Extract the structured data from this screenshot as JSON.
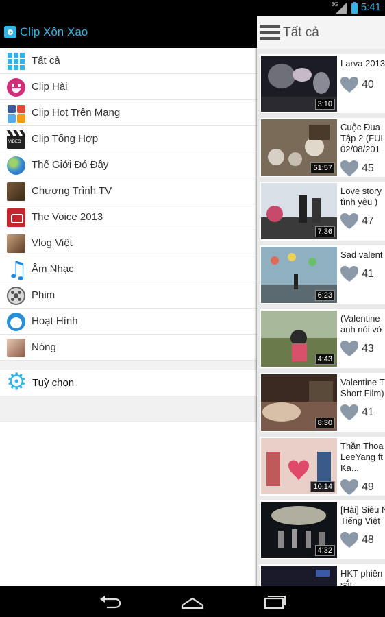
{
  "status": {
    "network": "3G",
    "time": "5:41"
  },
  "drawer": {
    "app_title": "Clip Xôn Xao",
    "items": [
      {
        "label": "Tất cả",
        "icon": "grid-icon"
      },
      {
        "label": "Clip Hài",
        "icon": "smiley-icon"
      },
      {
        "label": "Clip Hot Trên Mạng",
        "icon": "social-icon"
      },
      {
        "label": "Clip Tổng Hợp",
        "icon": "clapperboard-icon"
      },
      {
        "label": "Thế Giới Đó Đây",
        "icon": "globe-icon"
      },
      {
        "label": "Chương Trình TV",
        "icon": "tv-host-photo-icon"
      },
      {
        "label": "The Voice 2013",
        "icon": "the-voice-icon"
      },
      {
        "label": "Vlog Việt",
        "icon": "vlog-photo-icon"
      },
      {
        "label": "Âm Nhạc",
        "icon": "music-note-icon"
      },
      {
        "label": "Phim",
        "icon": "film-reel-icon"
      },
      {
        "label": "Hoạt Hình",
        "icon": "doraemon-icon"
      },
      {
        "label": "Nóng",
        "icon": "hot-photo-icon"
      }
    ],
    "options_label": "Tuỳ chọn"
  },
  "panel": {
    "title": "Tất cả",
    "videos": [
      {
        "title": "Larva 2013",
        "duration": "3:10",
        "likes": "40"
      },
      {
        "title": "Cuộc Đua\nTập 2 (FUL\n02/08/201",
        "duration": "51:57",
        "likes": "45"
      },
      {
        "title": "Love story\ntình yêu )",
        "duration": "7:36",
        "likes": "47"
      },
      {
        "title": "Sad valent",
        "duration": "6:23",
        "likes": "41"
      },
      {
        "title": "(Valentine\nanh nói vớ",
        "duration": "4:43",
        "likes": "43"
      },
      {
        "title": "Valentine T\nShort Film)",
        "duration": "8:30",
        "likes": "41"
      },
      {
        "title": "Thần Thoạ\nLeeYang ft\nKa...",
        "duration": "10:14",
        "likes": "49"
      },
      {
        "title": "[Hài] Siêu N\nTiếng Việt",
        "duration": "4:32",
        "likes": "48"
      },
      {
        "title": "HKT phiên\nsắt",
        "duration": "",
        "likes": ""
      }
    ]
  },
  "colors": {
    "accent": "#33b5e5",
    "heart": "#8a98a8"
  }
}
